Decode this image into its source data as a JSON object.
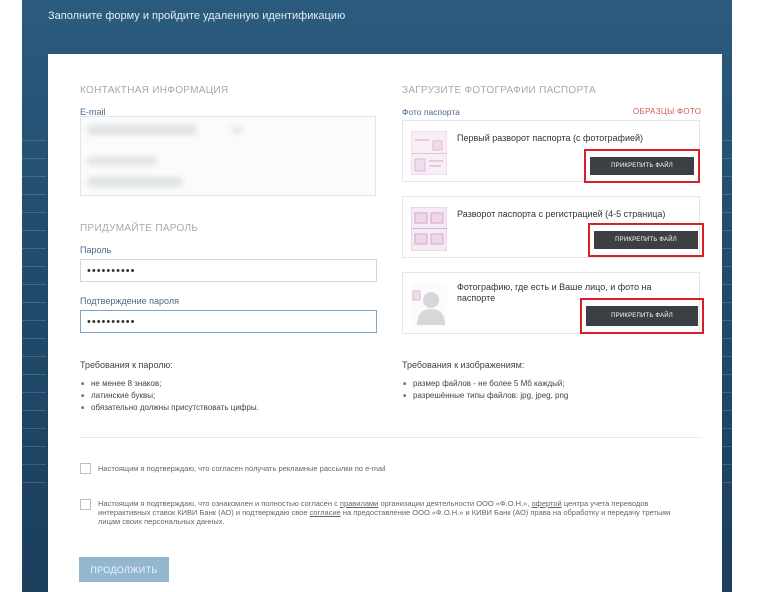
{
  "header": {
    "title": "Заполните форму и пройдите удаленную идентификацию"
  },
  "contact": {
    "section_title": "КОНТАКТНАЯ ИНФОРМАЦИЯ",
    "email_label": "E-mail"
  },
  "password": {
    "section_title": "ПРИДУМАЙТЕ ПАРОЛЬ",
    "password_label": "Пароль",
    "password_value": "••••••••••",
    "confirm_label": "Подтверждение пароля",
    "confirm_value": "••••••••••"
  },
  "password_requirements": {
    "title": "Требования к паролю:",
    "items": [
      "не менее 8 знаков;",
      "латинские буквы;",
      "обязательно должны присутствовать цифры."
    ]
  },
  "upload": {
    "section_title": "ЗАГРУЗИТЕ ФОТОГРАФИИ ПАСПОРТА",
    "subtitle": "Фото паспорта",
    "samples_link": "ОБРАЗЦЫ ФОТО",
    "cards": [
      {
        "text": "Первый разворот паспорта (с фотографией)",
        "button": "ПРИКРЕПИТЬ ФАЙЛ",
        "icon": "passport-photo-page-icon"
      },
      {
        "text": "Разворот паспорта с регистрацией (4-5 страница)",
        "button": "ПРИКРЕПИТЬ ФАЙЛ",
        "icon": "passport-registration-page-icon"
      },
      {
        "text": "Фотографию, где есть и Ваше лицо, и фото на паспорте",
        "button": "ПРИКРЕПИТЬ ФАЙЛ",
        "icon": "person-silhouette-icon"
      }
    ]
  },
  "image_requirements": {
    "title": "Требования к изображениям:",
    "items": [
      "размер файлов - не более 5 Мб каждый;",
      "разрешённые типы файлов: jpg, jpeg, png"
    ]
  },
  "consents": {
    "ads": "Настоящим я подтверждаю, что согласен получать рекламные рассылки по e-mail",
    "terms_part1": "Настоящим я подтверждаю, что ознакомлен и полностью согласен с ",
    "terms_link1": "правилами",
    "terms_part2": " организации деятельности ООО «Ф.О.Н.», ",
    "terms_link2": "офертой",
    "terms_part3": " центра учета переводов интерактивных ставок КИВИ Банк (АО) и подтверждаю свое ",
    "terms_link3": "согласие",
    "terms_part4": " на предоставление ООО «Ф.О.Н.» и КИВИ Банк (АО) права на обработку и передачу третьим лицам своих персональных данных."
  },
  "continue_label": "ПРОДОЛЖИТЬ",
  "colors": {
    "accent_red": "#d61f26",
    "header_blue": "#224c6d",
    "button_dark": "#3c3f43",
    "continue_blue": "#93b7cf"
  }
}
